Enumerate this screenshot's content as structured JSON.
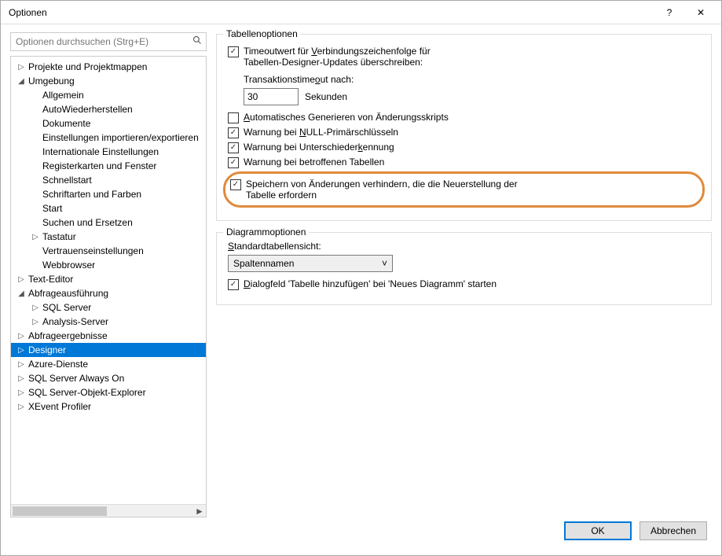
{
  "window": {
    "title": "Optionen"
  },
  "search": {
    "placeholder": "Optionen durchsuchen (Strg+E)"
  },
  "tree": [
    {
      "label": "Projekte und Projektmappen",
      "depth": 0,
      "arrow": "▷"
    },
    {
      "label": "Umgebung",
      "depth": 0,
      "arrow": "◢"
    },
    {
      "label": "Allgemein",
      "depth": 1,
      "arrow": ""
    },
    {
      "label": "AutoWiederherstellen",
      "depth": 1,
      "arrow": ""
    },
    {
      "label": "Dokumente",
      "depth": 1,
      "arrow": ""
    },
    {
      "label": "Einstellungen importieren/exportieren",
      "depth": 1,
      "arrow": ""
    },
    {
      "label": "Internationale Einstellungen",
      "depth": 1,
      "arrow": ""
    },
    {
      "label": "Registerkarten und Fenster",
      "depth": 1,
      "arrow": ""
    },
    {
      "label": "Schnellstart",
      "depth": 1,
      "arrow": ""
    },
    {
      "label": "Schriftarten und Farben",
      "depth": 1,
      "arrow": ""
    },
    {
      "label": "Start",
      "depth": 1,
      "arrow": ""
    },
    {
      "label": "Suchen und Ersetzen",
      "depth": 1,
      "arrow": ""
    },
    {
      "label": "Tastatur",
      "depth": 1,
      "arrow": "▷"
    },
    {
      "label": "Vertrauenseinstellungen",
      "depth": 1,
      "arrow": ""
    },
    {
      "label": "Webbrowser",
      "depth": 1,
      "arrow": ""
    },
    {
      "label": "Text-Editor",
      "depth": 0,
      "arrow": "▷"
    },
    {
      "label": "Abfrageausführung",
      "depth": 0,
      "arrow": "◢"
    },
    {
      "label": "SQL Server",
      "depth": 1,
      "arrow": "▷"
    },
    {
      "label": "Analysis-Server",
      "depth": 1,
      "arrow": "▷"
    },
    {
      "label": "Abfrageergebnisse",
      "depth": 0,
      "arrow": "▷"
    },
    {
      "label": "Designer",
      "depth": 0,
      "arrow": "▷",
      "selected": true
    },
    {
      "label": "Azure-Dienste",
      "depth": 0,
      "arrow": "▷"
    },
    {
      "label": "SQL Server Always On",
      "depth": 0,
      "arrow": "▷"
    },
    {
      "label": "SQL Server-Objekt-Explorer",
      "depth": 0,
      "arrow": "▷"
    },
    {
      "label": "XEvent Profiler",
      "depth": 0,
      "arrow": "▷"
    }
  ],
  "table_options": {
    "title": "Tabellenoptionen",
    "timeout_override": {
      "label_pre": "Timeoutwert für ",
      "label_u": "V",
      "label_mid": "erbindungszeichenfolge für",
      "label_line2": "Tabellen-Designer-Updates überschreiben:",
      "checked": true
    },
    "transaction_label_pre": "Transaktionstime",
    "transaction_label_u": "o",
    "transaction_label_post": "ut nach:",
    "transaction_value": "30",
    "seconds_label": "Sekunden",
    "auto_gen": {
      "label_u": "A",
      "label": "utomatisches Generieren von Änderungsskripts",
      "checked": false
    },
    "warn_null": {
      "label_pre": "Warnung bei ",
      "label_u": "N",
      "label_post": "ULL-Primärschlüsseln",
      "checked": true
    },
    "warn_diff": {
      "label_pre": "Warnung bei Unterschieder",
      "label_u": "k",
      "label_post": "ennung",
      "checked": true
    },
    "warn_aff": {
      "label": "Warnung bei betroffenen Tabellen",
      "checked": true
    },
    "prevent_save": {
      "label": "Speichern von Änderungen verhindern, die die Neuerstellung der Tabelle erfordern",
      "checked": true
    }
  },
  "diagram_options": {
    "title": "Diagrammoptionen",
    "default_view_label_u": "S",
    "default_view_label": "tandardtabellensicht:",
    "default_view_value": "Spaltennamen",
    "dialog_add": {
      "label_u": "D",
      "label": "ialogfeld 'Tabelle hinzufügen'  bei 'Neues Diagramm' starten",
      "checked": true
    }
  },
  "buttons": {
    "ok": "OK",
    "cancel": "Abbrechen"
  }
}
